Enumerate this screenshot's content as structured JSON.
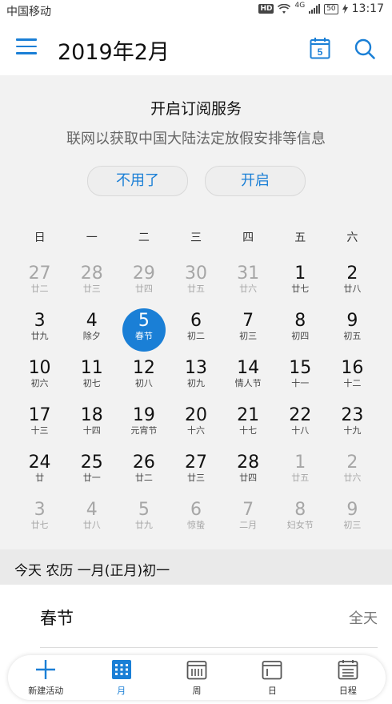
{
  "status_bar": {
    "carrier": "中国移动",
    "hd": "HD",
    "network": "4G",
    "battery": "50",
    "time": "13:17"
  },
  "header": {
    "title": "2019年2月",
    "calendar_icon_day": "5"
  },
  "subscribe": {
    "title": "开启订阅服务",
    "description": "联网以获取中国大陆法定放假安排等信息",
    "decline_label": "不用了",
    "accept_label": "开启"
  },
  "calendar": {
    "weekdays": [
      "日",
      "一",
      "二",
      "三",
      "四",
      "五",
      "六"
    ],
    "weeks": [
      [
        {
          "day": "27",
          "lunar": "廿二",
          "other": true
        },
        {
          "day": "28",
          "lunar": "廿三",
          "other": true
        },
        {
          "day": "29",
          "lunar": "廿四",
          "other": true
        },
        {
          "day": "30",
          "lunar": "廿五",
          "other": true
        },
        {
          "day": "31",
          "lunar": "廿六",
          "other": true
        },
        {
          "day": "1",
          "lunar": "廿七",
          "other": false
        },
        {
          "day": "2",
          "lunar": "廿八",
          "other": false
        }
      ],
      [
        {
          "day": "3",
          "lunar": "廿九",
          "other": false
        },
        {
          "day": "4",
          "lunar": "除夕",
          "other": false
        },
        {
          "day": "5",
          "lunar": "春节",
          "other": false,
          "today": true
        },
        {
          "day": "6",
          "lunar": "初二",
          "other": false
        },
        {
          "day": "7",
          "lunar": "初三",
          "other": false
        },
        {
          "day": "8",
          "lunar": "初四",
          "other": false
        },
        {
          "day": "9",
          "lunar": "初五",
          "other": false
        }
      ],
      [
        {
          "day": "10",
          "lunar": "初六",
          "other": false
        },
        {
          "day": "11",
          "lunar": "初七",
          "other": false
        },
        {
          "day": "12",
          "lunar": "初八",
          "other": false
        },
        {
          "day": "13",
          "lunar": "初九",
          "other": false
        },
        {
          "day": "14",
          "lunar": "情人节",
          "other": false
        },
        {
          "day": "15",
          "lunar": "十一",
          "other": false
        },
        {
          "day": "16",
          "lunar": "十二",
          "other": false
        }
      ],
      [
        {
          "day": "17",
          "lunar": "十三",
          "other": false
        },
        {
          "day": "18",
          "lunar": "十四",
          "other": false
        },
        {
          "day": "19",
          "lunar": "元宵节",
          "other": false
        },
        {
          "day": "20",
          "lunar": "十六",
          "other": false
        },
        {
          "day": "21",
          "lunar": "十七",
          "other": false
        },
        {
          "day": "22",
          "lunar": "十八",
          "other": false
        },
        {
          "day": "23",
          "lunar": "十九",
          "other": false
        }
      ],
      [
        {
          "day": "24",
          "lunar": "廿",
          "other": false
        },
        {
          "day": "25",
          "lunar": "廿一",
          "other": false
        },
        {
          "day": "26",
          "lunar": "廿二",
          "other": false
        },
        {
          "day": "27",
          "lunar": "廿三",
          "other": false
        },
        {
          "day": "28",
          "lunar": "廿四",
          "other": false
        },
        {
          "day": "1",
          "lunar": "廿五",
          "other": true
        },
        {
          "day": "2",
          "lunar": "廿六",
          "other": true
        }
      ],
      [
        {
          "day": "3",
          "lunar": "廿七",
          "other": true
        },
        {
          "day": "4",
          "lunar": "廿八",
          "other": true
        },
        {
          "day": "5",
          "lunar": "廿九",
          "other": true
        },
        {
          "day": "6",
          "lunar": "惊蛰",
          "other": true
        },
        {
          "day": "7",
          "lunar": "二月",
          "other": true
        },
        {
          "day": "8",
          "lunar": "妇女节",
          "other": true
        },
        {
          "day": "9",
          "lunar": "初三",
          "other": true
        }
      ]
    ]
  },
  "today_bar": {
    "text": "今天  农历 一月(正月)初一"
  },
  "events": [
    {
      "name": "春节",
      "time": "全天"
    }
  ],
  "bottom_nav": {
    "items": [
      {
        "label": "新建活动",
        "icon": "plus-icon"
      },
      {
        "label": "月",
        "icon": "month-grid-icon",
        "active": true
      },
      {
        "label": "周",
        "icon": "week-icon"
      },
      {
        "label": "日",
        "icon": "day-icon"
      },
      {
        "label": "日程",
        "icon": "agenda-icon"
      }
    ]
  },
  "colors": {
    "accent": "#1a7fd6",
    "muted_day": "#a6a6a6"
  }
}
